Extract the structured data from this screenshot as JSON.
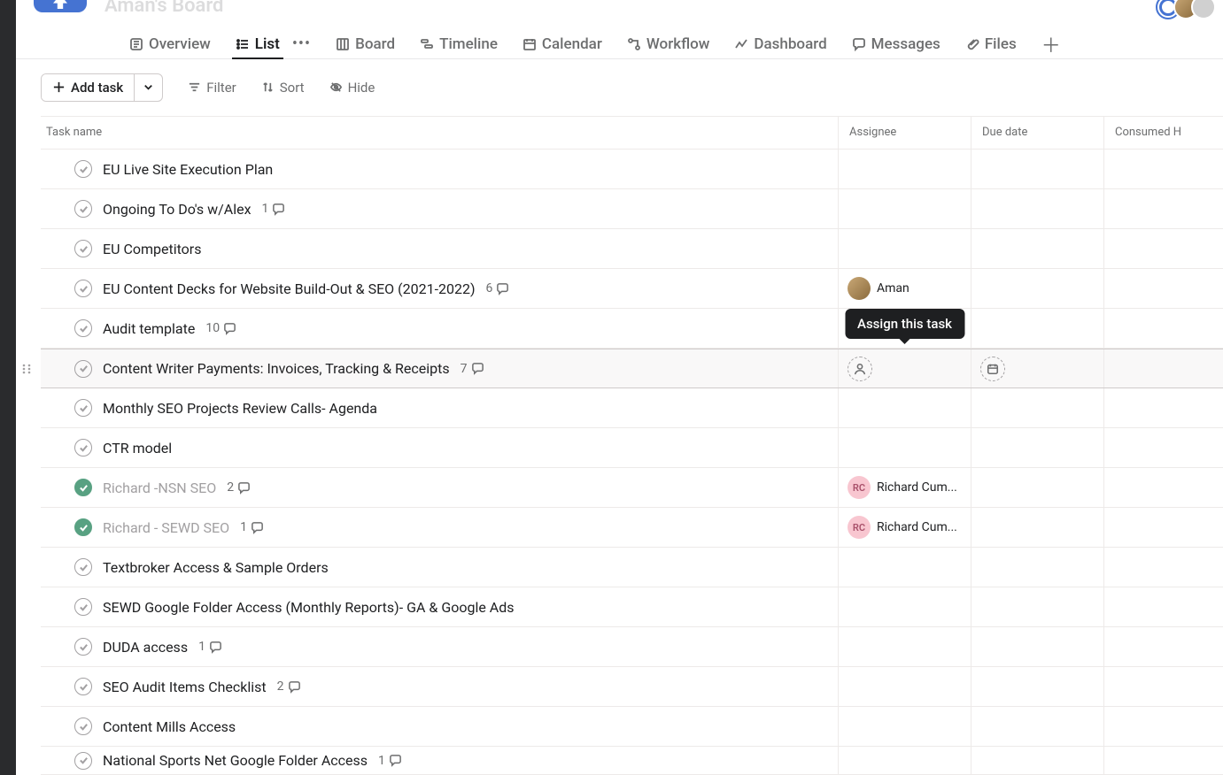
{
  "project": {
    "title": "Aman's Board"
  },
  "tabs": [
    {
      "id": "overview",
      "label": "Overview",
      "icon": "overview"
    },
    {
      "id": "list",
      "label": "List",
      "icon": "list",
      "active": true
    },
    {
      "id": "board",
      "label": "Board",
      "icon": "board"
    },
    {
      "id": "timeline",
      "label": "Timeline",
      "icon": "timeline"
    },
    {
      "id": "calendar",
      "label": "Calendar",
      "icon": "calendar"
    },
    {
      "id": "workflow",
      "label": "Workflow",
      "icon": "workflow"
    },
    {
      "id": "dashboard",
      "label": "Dashboard",
      "icon": "dashboard"
    },
    {
      "id": "messages",
      "label": "Messages",
      "icon": "messages"
    },
    {
      "id": "files",
      "label": "Files",
      "icon": "files"
    }
  ],
  "toolbar": {
    "add_task": "Add task",
    "filter": "Filter",
    "sort": "Sort",
    "hide": "Hide"
  },
  "columns": {
    "task": "Task name",
    "assignee": "Assignee",
    "due": "Due date",
    "consumed": "Consumed H"
  },
  "tooltip": {
    "assign": "Assign this task"
  },
  "tasks": [
    {
      "name": "EU Live Site Execution Plan"
    },
    {
      "name": "Ongoing To Do's w/Alex",
      "comments": 1
    },
    {
      "name": "EU Competitors"
    },
    {
      "name": "EU Content Decks for Website Build-Out & SEO (2021-2022)",
      "comments": 6,
      "assignee": {
        "name": "Aman",
        "type": "photo"
      }
    },
    {
      "name": "Audit template",
      "comments": 10
    },
    {
      "name": "Content Writer Payments: Invoices, Tracking & Receipts",
      "comments": 7,
      "hovered": true
    },
    {
      "name": "Monthly SEO Projects Review Calls- Agenda"
    },
    {
      "name": "CTR model"
    },
    {
      "name": "Richard -NSN SEO",
      "comments": 2,
      "completed": true,
      "assignee": {
        "name": "Richard Cum...",
        "initials": "RC",
        "type": "initials"
      }
    },
    {
      "name": "Richard - SEWD SEO",
      "comments": 1,
      "completed": true,
      "assignee": {
        "name": "Richard Cum...",
        "initials": "RC",
        "type": "initials"
      }
    },
    {
      "name": "Textbroker Access & Sample Orders"
    },
    {
      "name": "SEWD Google Folder Access (Monthly Reports)- GA & Google Ads"
    },
    {
      "name": "DUDA access",
      "comments": 1
    },
    {
      "name": "SEO Audit Items Checklist",
      "comments": 2
    },
    {
      "name": "Content Mills Access"
    },
    {
      "name": "National Sports Net Google Folder Access",
      "comments": 1,
      "cut": true
    }
  ]
}
